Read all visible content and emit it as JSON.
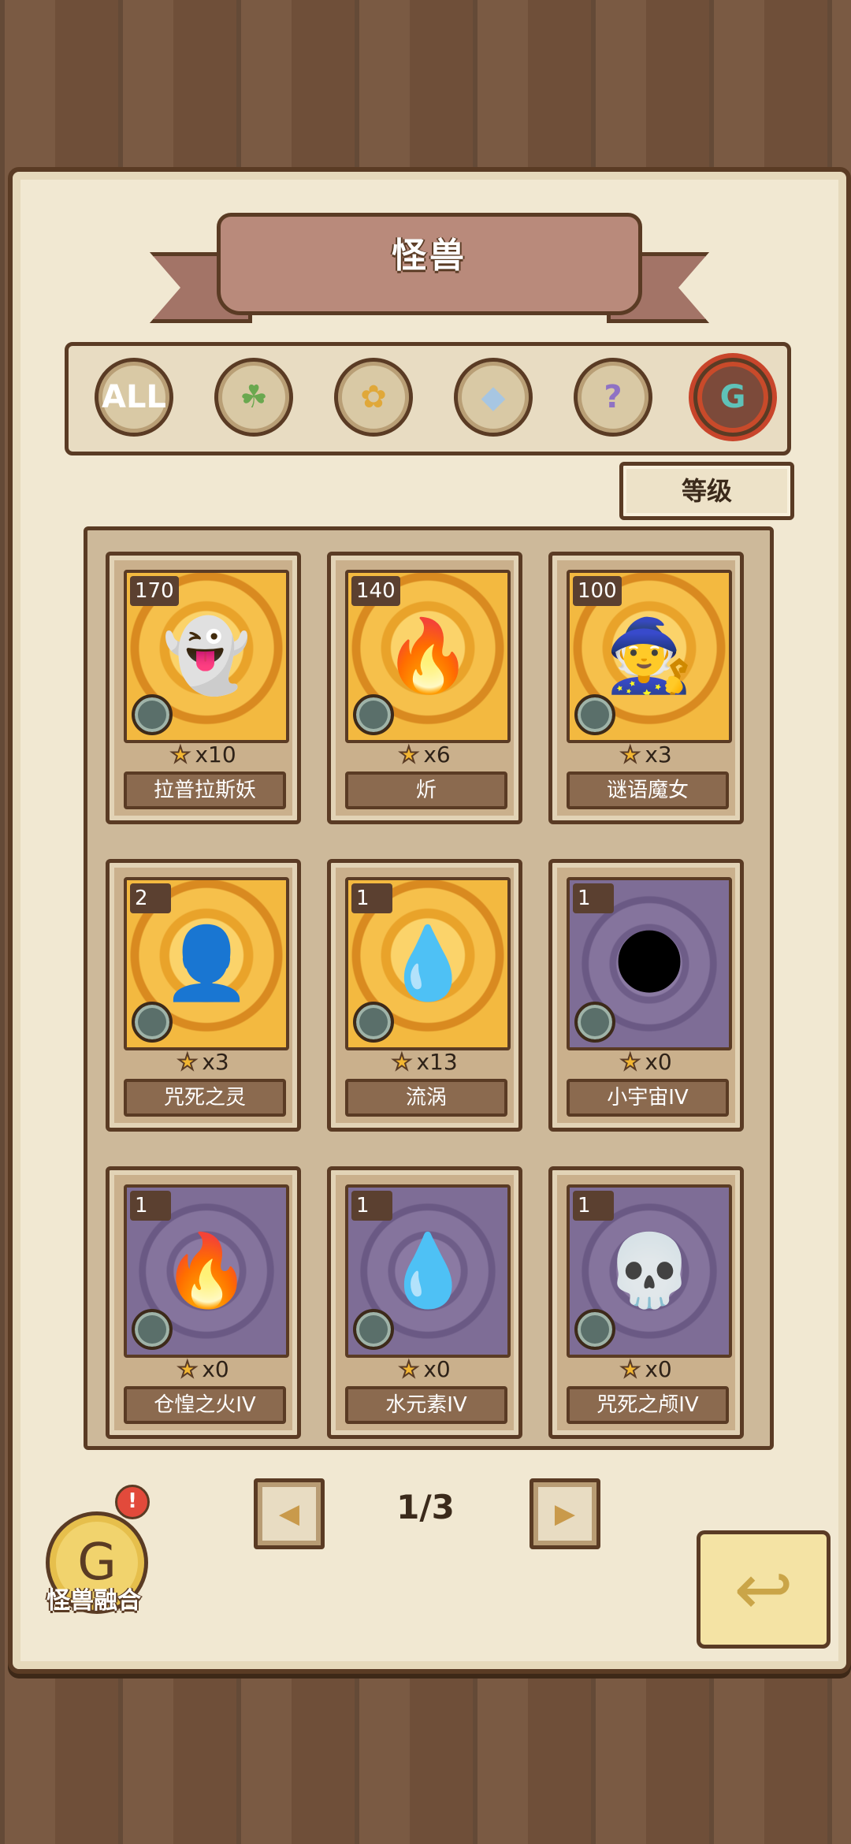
{
  "header": {
    "title": "怪兽"
  },
  "filters": [
    {
      "label": "ALL",
      "icon": "all-icon"
    },
    {
      "label": "",
      "icon": "leaf-icon"
    },
    {
      "label": "",
      "icon": "paw-icon"
    },
    {
      "label": "",
      "icon": "crystal-icon"
    },
    {
      "label": "",
      "icon": "question-icon"
    },
    {
      "label": "",
      "icon": "rune-icon",
      "active": true
    }
  ],
  "sort": {
    "label": "等级"
  },
  "cards": [
    {
      "level": "170",
      "count": "x10",
      "name": "拉普拉斯妖",
      "bg": "gold",
      "emoji": "👻"
    },
    {
      "level": "140",
      "count": "x6",
      "name": "炘",
      "bg": "gold",
      "emoji": "🔥"
    },
    {
      "level": "100",
      "count": "x3",
      "name": "谜语魔女",
      "bg": "gold",
      "emoji": "🧙"
    },
    {
      "level": "2",
      "count": "x3",
      "name": "咒死之灵",
      "bg": "gold",
      "emoji": "👤"
    },
    {
      "level": "1",
      "count": "x13",
      "name": "流涡",
      "bg": "gold",
      "emoji": "💧"
    },
    {
      "level": "1",
      "count": "x0",
      "name": "小宇宙IV",
      "bg": "purple",
      "emoji": "🌑"
    },
    {
      "level": "1",
      "count": "x0",
      "name": "仓惶之火IV",
      "bg": "purple",
      "emoji": "🔥"
    },
    {
      "level": "1",
      "count": "x0",
      "name": "水元素IV",
      "bg": "purple",
      "emoji": "💧"
    },
    {
      "level": "1",
      "count": "x0",
      "name": "咒死之颅IV",
      "bg": "purple",
      "emoji": "💀"
    }
  ],
  "pager": {
    "text": "1/3",
    "prev": "◀",
    "next": "▶"
  },
  "fusion": {
    "label": "怪兽融合",
    "alert": "!"
  },
  "back": {
    "icon": "return-arrow-icon"
  }
}
